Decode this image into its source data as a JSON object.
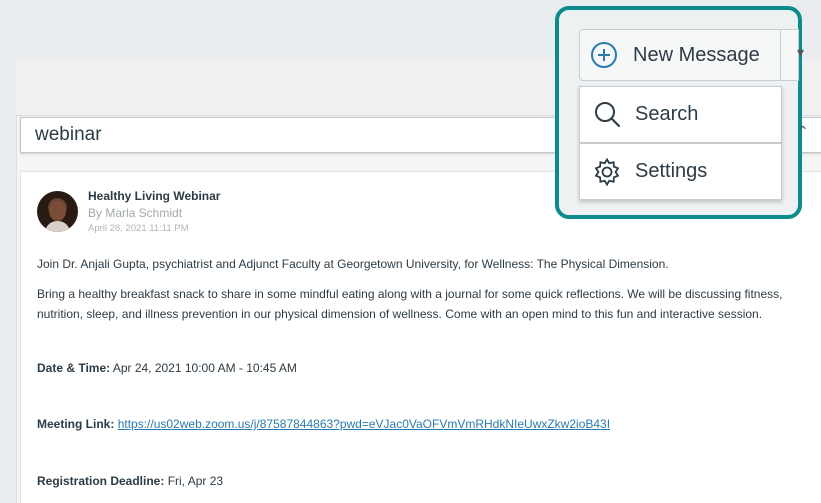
{
  "search": {
    "value": "webinar"
  },
  "toolbar": {
    "new_message_label": "New Message",
    "new_message_icon": "plus-circle-icon",
    "menu": [
      {
        "label": "Search",
        "icon": "magnifier-icon"
      },
      {
        "label": "Settings",
        "icon": "gear-icon"
      }
    ]
  },
  "post": {
    "title": "Healthy Living Webinar",
    "author": "By Marla Schmidt",
    "date": "April 28, 2021 11:11 PM",
    "intro": "Join Dr. Anjali Gupta, psychiatrist and Adjunct Faculty at Georgetown University, for Wellness: The Physical Dimension.",
    "body_line1": "Bring a healthy breakfast snack to share in some mindful eating along with a journal for some quick reflections. We will be discussing fitness,",
    "body_line2": "nutrition, sleep, and illness prevention in our physical dimension of wellness. Come with an open mind to this fun and interactive session.",
    "date_time_label": "Date & Time:",
    "date_time_value": " Apr 24, 2021 10:00 AM - 10:45 AM",
    "meeting_label": "Meeting Link:",
    "meeting_link": "https://us02web.zoom.us/j/87587844863?pwd=eVJac0VaOFVmVmRHdkNIeUwxZkw2ioB43I",
    "deadline_label": "Registration Deadline:",
    "deadline_value": " Fri, Apr 23"
  },
  "colors": {
    "highlight": "#0b8b8b",
    "link": "#2a7ab0",
    "text": "#2d3b45"
  }
}
